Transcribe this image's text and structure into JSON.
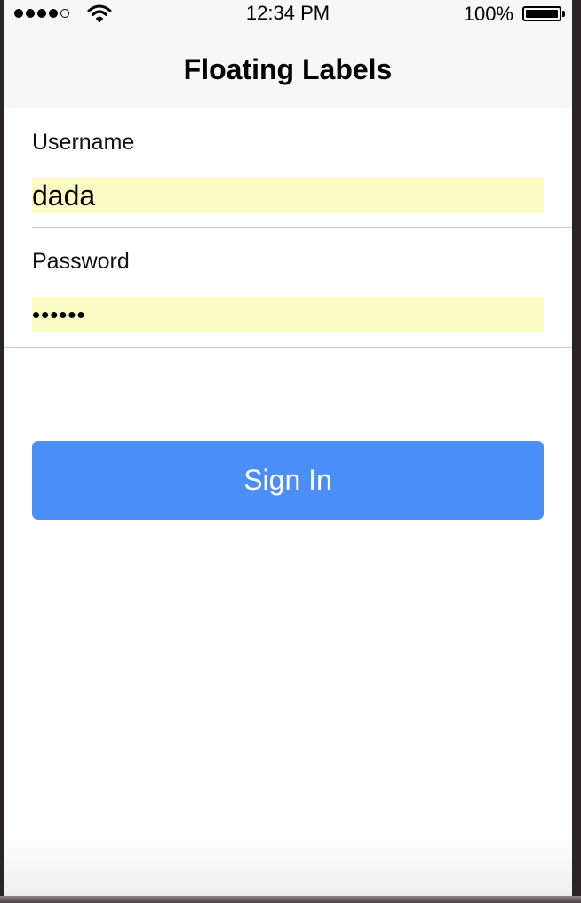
{
  "status_bar": {
    "time": "12:34 PM",
    "battery_percent": "100%",
    "signal_bars_filled": 4,
    "signal_bars_total": 5,
    "icons": [
      "signal-dots-icon",
      "wifi-icon",
      "battery-icon"
    ]
  },
  "nav": {
    "title": "Floating Labels"
  },
  "form": {
    "username": {
      "label": "Username",
      "value": "dada"
    },
    "password": {
      "label": "Password",
      "value": "••••••"
    },
    "autofill_color": "#fafcc4"
  },
  "actions": {
    "sign_in_label": "Sign In",
    "sign_in_color": "#4b8ef8"
  }
}
